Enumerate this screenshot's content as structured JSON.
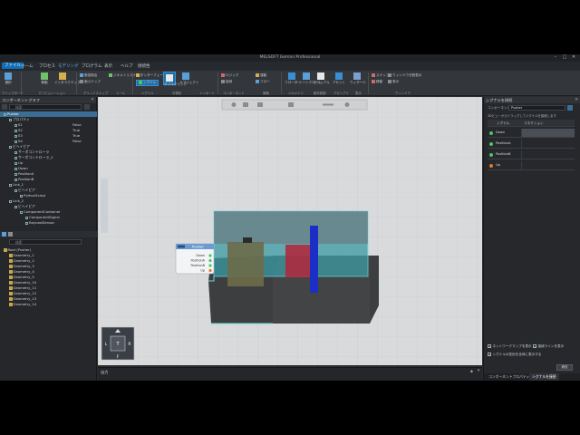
{
  "app": {
    "title": "MELSOFT Gemini Professional",
    "win_controls": [
      "–",
      "□",
      "✕"
    ]
  },
  "menu": [
    "ファイル",
    "ホーム",
    "プロセス",
    "モデリング",
    "プログラム",
    "表示",
    "ヘルプ",
    "接続性"
  ],
  "ribbon": {
    "buttons": [
      "選択",
      "移動",
      "インタラクティブ",
      "ダブルクリック",
      "オブジェクト",
      "フローター",
      "シーンクローン",
      "ビジュアル",
      "アセット",
      "ウィザード"
    ],
    "small_items": [
      "衝突検出",
      "面スナップ",
      "ジオメトリスナップ",
      "インターフェース",
      "シグナル",
      "運動",
      "ロジック",
      "接続",
      "フロー",
      "スナップ",
      "移動",
      "ウィンドウ分割表示",
      "表示"
    ],
    "groups": [
      "クリップボード",
      "マニピュレーション",
      "グリッドスナップ",
      "ツール",
      "シグナル",
      "可視化",
      "インポート",
      "コンポーネント",
      "構築",
      "ジオメトリ",
      "動作制御",
      "アセンブリ",
      "表示",
      "ウィンドウ"
    ]
  },
  "left": {
    "component_title": "コンポーネントグラフ",
    "component_search": "検索",
    "component_tree": [
      {
        "label": "Pusher",
        "value": "",
        "selected": true
      },
      {
        "label": "プロパティ",
        "value": ""
      },
      {
        "label": "S1",
        "value": "False"
      },
      {
        "label": "S2",
        "value": "True"
      },
      {
        "label": "S3",
        "value": "True"
      },
      {
        "label": "S4",
        "value": "False"
      },
      {
        "label": "ビヘイビア",
        "value": ""
      },
      {
        "label": "サーボコントローラ",
        "value": ""
      },
      {
        "label": "サーボコントローラ_2",
        "value": ""
      },
      {
        "label": "Up",
        "value": ""
      },
      {
        "label": "Down",
        "value": ""
      },
      {
        "label": "PositionA",
        "value": ""
      },
      {
        "label": "PositionB",
        "value": ""
      },
      {
        "label": "Link_1",
        "value": ""
      },
      {
        "label": "ビヘイビア",
        "value": ""
      },
      {
        "label": "PythonScript",
        "value": ""
      },
      {
        "label": "Link_2",
        "value": ""
      },
      {
        "label": "ビヘイビア",
        "value": ""
      },
      {
        "label": "ComponentContainer",
        "value": ""
      },
      {
        "label": "ComponentSignal",
        "value": ""
      },
      {
        "label": "RaycastSensor",
        "value": ""
      }
    ],
    "geometry_search": "検索",
    "geometry_tree": [
      "Root (Pusher)",
      "Geometry_1",
      "Geometry_2",
      "Geometry_3",
      "Geometry_4",
      "Geometry_5",
      "Geometry_10",
      "Geometry_11",
      "Geometry_12",
      "Geometry_13",
      "Geometry_14"
    ]
  },
  "viewport": {
    "toolbar_icons": [
      "home-icon",
      "camera-icon",
      "grid-icon",
      "layers-icon",
      "measure-icon",
      "settings-icon"
    ],
    "signal_popup": {
      "title": "Pusher",
      "rows": [
        "Down",
        "PositionA",
        "PositionB",
        "Up"
      ]
    },
    "navcube": {
      "top": "T",
      "left": "L",
      "right": "R",
      "bottom": "F"
    }
  },
  "output": {
    "title": "出力"
  },
  "right": {
    "title": "シグナルを接続",
    "component_label": "コンポーネント",
    "component_value": "Pusher",
    "hint": "3Dビューからドラッグしてシグナルを接続します",
    "col_signal": "シグナル",
    "col_connection": "コネクション",
    "signals": [
      {
        "name": "Down",
        "color": "#4cc46a"
      },
      {
        "name": "PositionA",
        "color": "#4cc46a"
      },
      {
        "name": "PositionB",
        "color": "#4cc46a"
      },
      {
        "name": "Up",
        "color": "#e07a2e"
      }
    ],
    "checkboxes": [
      {
        "label": "ネットワークマップを表示",
        "checked": true
      },
      {
        "label": "接続ラインを表示",
        "checked": true
      },
      {
        "label": "シグナルの変化を全体に表示する",
        "checked": true
      }
    ],
    "clear_button": "消去",
    "tabs": [
      "コンポーネントプロパティ",
      "シグナルを接続"
    ]
  },
  "colors": {
    "accent": "#0e6fb8",
    "selection": "#3a6e94",
    "signal_green": "#4cc46a",
    "signal_orange": "#e07a2e"
  }
}
